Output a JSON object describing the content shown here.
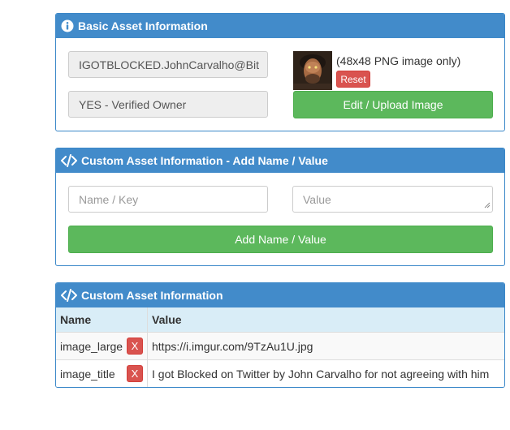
{
  "basic": {
    "title": "Basic Asset Information",
    "asset_name": "IGOTBLOCKED.JohnCarvalho@Bit",
    "owner_status": "YES - Verified Owner",
    "image_hint": "(48x48 PNG image only)",
    "reset_label": "Reset",
    "upload_label": "Edit / Upload Image"
  },
  "custom_add": {
    "title": "Custom Asset Information - Add Name / Value",
    "name_placeholder": "Name / Key",
    "value_placeholder": "Value",
    "add_label": "Add Name / Value"
  },
  "custom_table": {
    "title": "Custom Asset Information",
    "headers": [
      "Name",
      "Value"
    ],
    "rows": [
      {
        "name": "image_large",
        "delete": "X",
        "value": "https://i.imgur.com/9TzAu1U.jpg"
      },
      {
        "name": "image_title",
        "delete": "X",
        "value": "I got Blocked on Twitter by John Carvalho for not agreeing with him"
      }
    ]
  },
  "colors": {
    "panel_header": "#428bca",
    "button_green": "#5cb85c",
    "button_red": "#d9534f"
  },
  "icons": [
    "info-circle-icon",
    "code-icon"
  ]
}
